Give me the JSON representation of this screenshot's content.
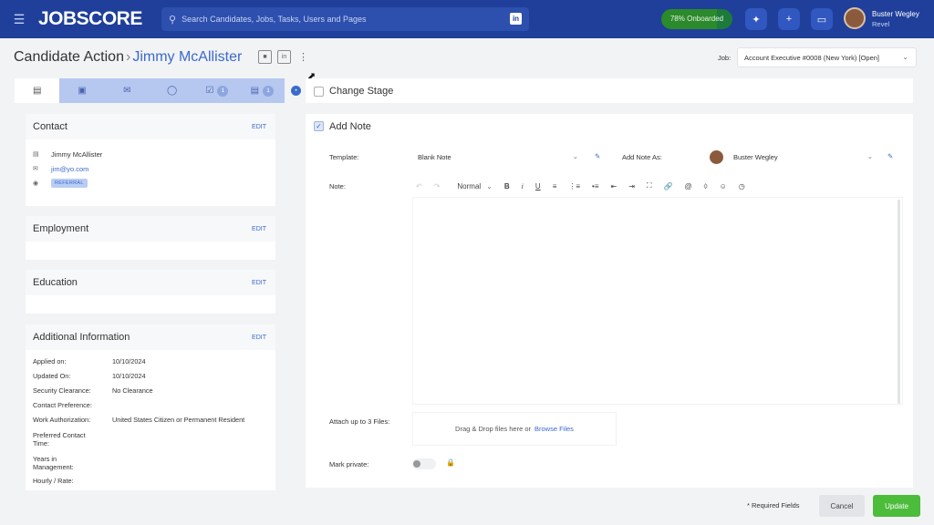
{
  "app": {
    "logo": "JOBSCORE",
    "search_placeholder": "Search Candidates, Jobs, Tasks, Users and Pages",
    "onboarded_label": "78% Onboarded",
    "onboarded_progress": 0.78,
    "user_name": "Buster Wegley",
    "user_org": "Revel"
  },
  "header": {
    "title": "Candidate Action",
    "candidate": "Jimmy McAllister",
    "job_label": "Job:",
    "job_value": "Account Executive #0008 (New York) [Open]"
  },
  "tabs": [
    {
      "name": "profile-tab",
      "icon": "id-card-icon",
      "badge": ""
    },
    {
      "name": "notes-tab",
      "icon": "note-icon",
      "badge": ""
    },
    {
      "name": "email-tab",
      "icon": "envelope-icon",
      "badge": ""
    },
    {
      "name": "chrome-tab",
      "icon": "circle-icon",
      "badge": ""
    },
    {
      "name": "tasks-tab",
      "icon": "checklist-icon",
      "badge": "1"
    },
    {
      "name": "documents-tab",
      "icon": "document-icon",
      "badge": "1"
    }
  ],
  "contact": {
    "title": "Contact",
    "edit": "EDIT",
    "name": "Jimmy McAllister",
    "email": "jim@yo.com",
    "source": "REFERRAL"
  },
  "employment": {
    "title": "Employment",
    "edit": "EDIT"
  },
  "education": {
    "title": "Education",
    "edit": "EDIT"
  },
  "additional": {
    "title": "Additional Information",
    "edit": "EDIT",
    "rows": [
      {
        "k": "Applied on:",
        "v": "10/10/2024"
      },
      {
        "k": "Updated On:",
        "v": "10/10/2024"
      },
      {
        "k": "Security Clearance:",
        "v": "No Clearance"
      },
      {
        "k": "Contact Preference:",
        "v": ""
      },
      {
        "k": "Work Authorization:",
        "v": "United States Citizen or Permanent Resident"
      },
      {
        "k": "Preferred Contact Time:",
        "v": ""
      },
      {
        "k": "Years in Management:",
        "v": ""
      },
      {
        "k": "Hourly / Rate:",
        "v": ""
      }
    ]
  },
  "action": {
    "change_stage": "Change Stage",
    "add_note": "Add Note",
    "template_label": "Template:",
    "template_value": "Blank Note",
    "note_as_label": "Add Note As:",
    "note_as_value": "Buster Wegley",
    "note_label": "Note:",
    "format_value": "Normal",
    "attach_label": "Attach up to 3 Files:",
    "drop_text": "Drag & Drop files here or",
    "browse_text": "Browse Files",
    "private_label": "Mark private:"
  },
  "footer": {
    "required": "* Required Fields",
    "cancel": "Cancel",
    "update": "Update"
  },
  "colors": {
    "brand": "#1f3f9a",
    "accent": "#3b6acb",
    "success": "#4cbc3b"
  }
}
